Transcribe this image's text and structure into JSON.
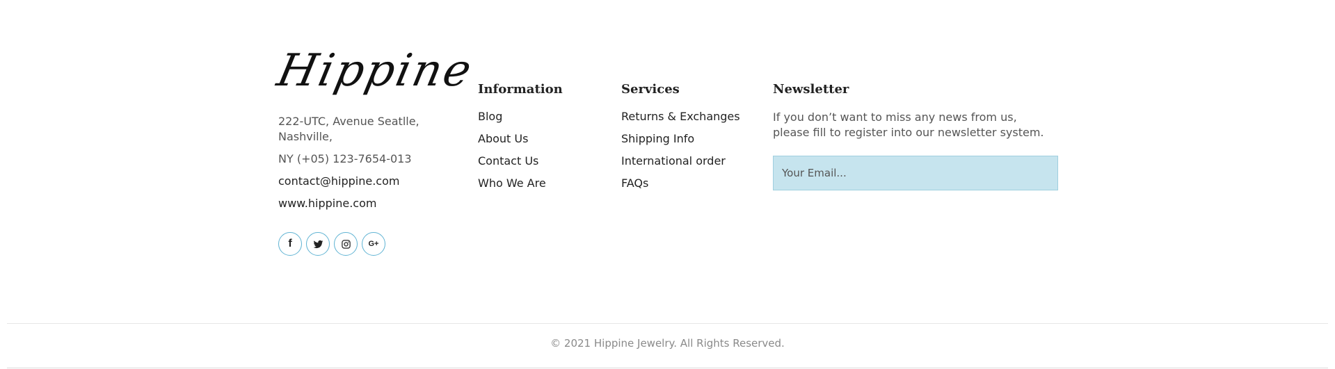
{
  "brand": {
    "logo_text": "Hippine"
  },
  "contact": {
    "address_line1": "222-UTC, Avenue Seatlle,",
    "address_line2": "Nashville,",
    "phone": "NY (+05) 123-7654-013",
    "email": "contact@hippine.com",
    "website": "www.hippine.com"
  },
  "socials": [
    {
      "name": "facebook-icon",
      "glyph": "f"
    },
    {
      "name": "twitter-icon",
      "glyph": ""
    },
    {
      "name": "instagram-icon",
      "glyph": ""
    },
    {
      "name": "google-plus-icon",
      "glyph": "G+"
    }
  ],
  "information": {
    "title": "Information",
    "items": [
      "Blog",
      "About Us",
      "Contact Us",
      "Who We Are"
    ]
  },
  "services": {
    "title": "Services",
    "items": [
      "Returns & Exchanges",
      "Shipping Info",
      "International order",
      "FAQs"
    ]
  },
  "newsletter": {
    "title": "Newsletter",
    "text_line1": "If you don’t want to miss any news from us,",
    "text_line2": "please fill to register into our newsletter system.",
    "placeholder": "Your Email..."
  },
  "footer": {
    "copyright": "© 2021 Hippine Jewelry. All Rights Reserved."
  },
  "colors": {
    "accent_border": "#5fb3d3",
    "input_bg": "#c6e4ee"
  }
}
